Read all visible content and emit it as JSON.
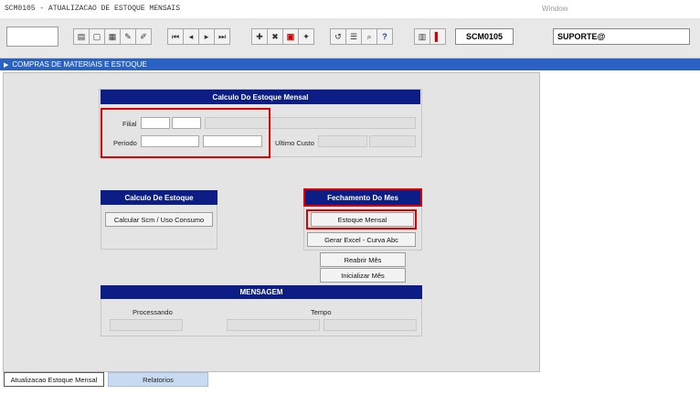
{
  "window": {
    "title": "SCM0105 - ATUALIZACAO DE ESTOQUE MENSAIS",
    "menu": "Window"
  },
  "toolbar": {
    "program_code": "SCM0105",
    "user": "SUPORTE@",
    "icons": [
      "save-icon",
      "clear-icon",
      "print-icon",
      "pen-icon",
      "edit-icon",
      "first-record-icon",
      "previous-record-icon",
      "next-record-icon",
      "last-record-icon",
      "insert-icon",
      "delete-icon",
      "duplicate-icon",
      "query-icon",
      "undo-icon",
      "list-icon",
      "lookup-icon",
      "help-icon",
      "calculator-icon",
      "exit-icon"
    ]
  },
  "module_bar": {
    "label": "COMPRAS DE MATERIAIS E ESTOQUE"
  },
  "calc_mensal": {
    "header": "Calculo Do Estoque Mensal",
    "filial_label": "Filial",
    "periodo_label": "Periodo",
    "ultimo_custo_label": "Ultimo Custo"
  },
  "calc_estoque": {
    "header": "Calculo De Estoque",
    "button": "Calcular Scm / Uso Consumo"
  },
  "fechamento": {
    "header": "Fechamento Do Mes",
    "estoque_mensal": "Estoque Mensal",
    "gerar_excel": "Gerar Excel - Curva Abc",
    "reabrir": "Reabrir Mês",
    "inicializar": "Inicializar Mês"
  },
  "mensagem": {
    "header": "MENSAGEM",
    "processando_label": "Processando",
    "tempo_label": "Tempo"
  },
  "tabs": [
    "Atualizacao Estoque Mensal",
    "Relatorios"
  ],
  "colors": {
    "header_navy": "#0c1e85",
    "module_blue": "#2a62c4",
    "highlight_red": "#e00000"
  }
}
